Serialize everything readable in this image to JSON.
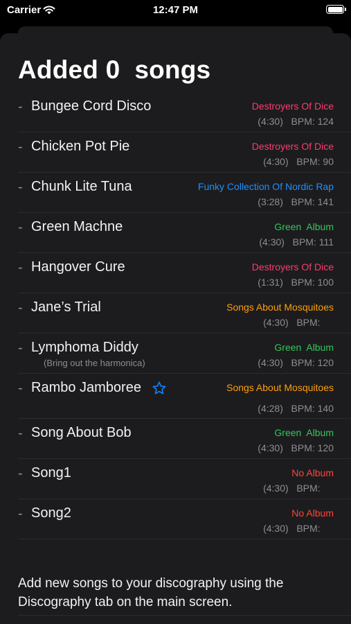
{
  "status_bar": {
    "carrier": "Carrier",
    "time": "12:47 PM"
  },
  "header": {
    "title": "Added 0  songs"
  },
  "songs": [
    {
      "title": "Bungee Cord Disco",
      "subtitle": "",
      "album": "Destroyers Of Dice",
      "album_color": "#ff3b6b",
      "meta": "(4:30)   BPM: 124",
      "starred": false
    },
    {
      "title": "Chicken Pot Pie",
      "subtitle": "",
      "album": "Destroyers Of Dice",
      "album_color": "#ff3b6b",
      "meta": "(4:30)   BPM: 90",
      "starred": false
    },
    {
      "title": "Chunk Lite Tuna",
      "subtitle": "",
      "album": "Funky Collection Of Nordic Rap",
      "album_color": "#1e90ff",
      "meta": "(3:28)   BPM: 141",
      "starred": false
    },
    {
      "title": "Green Machne",
      "subtitle": "",
      "album": "Green  Album",
      "album_color": "#34c759",
      "meta": "(4:30)   BPM: 111",
      "starred": false
    },
    {
      "title": "Hangover Cure",
      "subtitle": "",
      "album": "Destroyers Of Dice",
      "album_color": "#ff3b6b",
      "meta": "(1:31)   BPM: 100",
      "starred": false
    },
    {
      "title": "Jane’s Trial",
      "subtitle": "",
      "album": "Songs About Mosquitoes",
      "album_color": "#ff9f0a",
      "meta": "(4:30)   BPM:     ",
      "starred": false
    },
    {
      "title": "Lymphoma Diddy",
      "subtitle": "(Bring out the harmonica)",
      "album": "Green  Album",
      "album_color": "#34c759",
      "meta": "(4:30)   BPM: 120",
      "starred": false
    },
    {
      "title": "Rambo Jamboree",
      "subtitle": "",
      "album": "Songs About Mosquitoes",
      "album_color": "#ff9f0a",
      "meta": "(4:28)   BPM: 140",
      "starred": true
    },
    {
      "title": "Song About Bob",
      "subtitle": "",
      "album": "Green  Album",
      "album_color": "#34c759",
      "meta": "(4:30)   BPM: 120",
      "starred": false
    },
    {
      "title": "Song1",
      "subtitle": "",
      "album": "No Album",
      "album_color": "#ff453a",
      "meta": "(4:30)   BPM:     ",
      "starred": false
    },
    {
      "title": "Song2",
      "subtitle": "",
      "album": "No Album",
      "album_color": "#ff453a",
      "meta": "(4:30)   BPM:     ",
      "starred": false
    }
  ],
  "footer": {
    "text": "Add new songs to your discography using the Discography tab on the main screen."
  },
  "icons": {
    "wifi": "wifi-icon",
    "battery": "battery-icon",
    "star": "star-icon"
  },
  "colors": {
    "sheet_bg": "#1c1c1e",
    "star": "#0a84ff"
  }
}
